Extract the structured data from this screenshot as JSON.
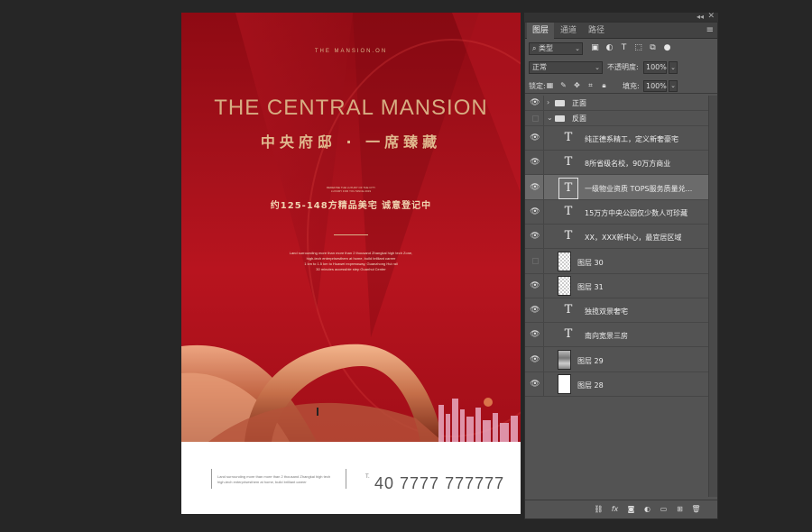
{
  "poster": {
    "brand_mirror": "THE MANSION.ON",
    "title": "THE CENTRAL MANSION",
    "subtitle": "中央府邸 · 一席臻藏",
    "micro_text": "REDEFINE THE LUXURY OF THE CITY\nLUXURY FOR YOU SINCE 2019",
    "tagline": "约125-148方精品美宅   诚意登记中",
    "description": "Land surrounding more than more than 2 thousand Zhangkai high tech Zone,\nhigh-tech enterprisesthem at home, build brilliant career\n1 km to 1.5 km to Huawei expressway, Guanzhong Hui rail\n30 minutes accessible step Guanhui Center",
    "footer_text": "Land surrounding more than more than 2 thousand Zhangkai high tech\nhigh-tech enterprisesthem at home, build brilliant career",
    "tel_label": "T.",
    "phone": "40 7777 777777"
  },
  "panel": {
    "tabs": [
      "图层",
      "通道",
      "路径"
    ],
    "filter_select": "类型",
    "blend_mode": "正常",
    "opacity_label": "不透明度:",
    "opacity_value": "100%",
    "lock_label": "锁定:",
    "fill_label": "填充:",
    "fill_value": "100%",
    "layers": [
      {
        "type": "group",
        "name": "正面",
        "visible": true,
        "expanded": false
      },
      {
        "type": "group",
        "name": "反面",
        "visible": false,
        "expanded": true
      },
      {
        "type": "text",
        "name": "纯正德系精工，定义新奢豪宅",
        "visible": true
      },
      {
        "type": "text",
        "name": "8所省级名校，90万方商业",
        "visible": true
      },
      {
        "type": "text",
        "name": "一级物业资质 TOPS服务质量兑...",
        "visible": true,
        "selected": true
      },
      {
        "type": "text",
        "name": "15万方中央公园仅少数人可珍藏",
        "visible": true
      },
      {
        "type": "text",
        "name": "XX，XXX新中心，最宜居区域",
        "visible": true
      },
      {
        "type": "image",
        "name": "图层 30",
        "visible": false,
        "thumb": "transparent"
      },
      {
        "type": "image",
        "name": "图层 31",
        "visible": true,
        "thumb": "transparent"
      },
      {
        "type": "text",
        "name": "独揽双景奢宅",
        "visible": true
      },
      {
        "type": "text",
        "name": "南向宽景三房",
        "visible": true
      },
      {
        "type": "image",
        "name": "图层 29",
        "visible": true,
        "thumb": "photo"
      },
      {
        "type": "image",
        "name": "图层 28",
        "visible": true,
        "thumb": "white"
      }
    ]
  },
  "colors": {
    "poster_red": "#a5111b",
    "gold": "#d7ad82",
    "panel_bg": "#535353",
    "app_bg": "#262626"
  }
}
